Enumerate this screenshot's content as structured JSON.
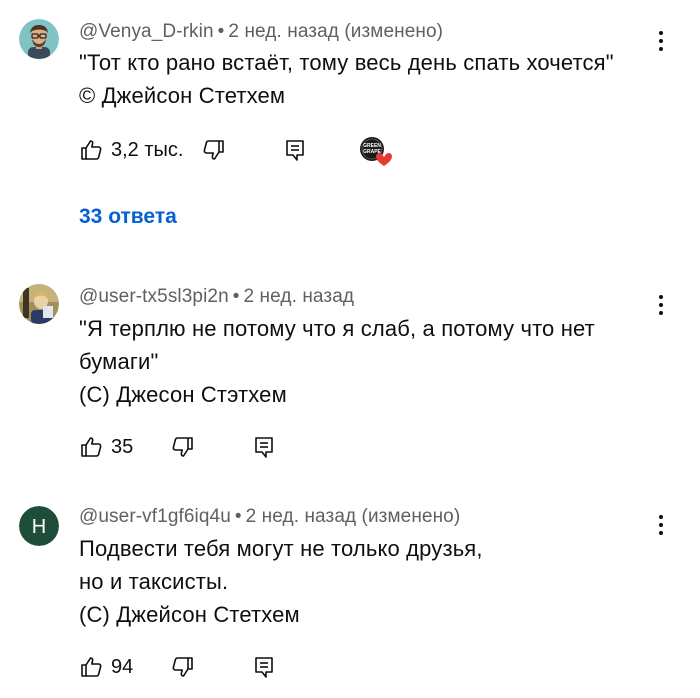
{
  "comments": [
    {
      "author": "@Venya_D-rkin",
      "time": "2 нед. назад (изменено)",
      "lines": [
        "\"Тот кто рано встаёт, тому весь день спать хочется\"",
        "© Джейсон Стетхем"
      ],
      "likes": "3,2 тыс.",
      "replies": "33 ответа",
      "creator_heart": true,
      "creator_badge_text": "GREEN GRAPE"
    },
    {
      "author": "@user-tx5sl3pi2n",
      "time": "2 нед. назад",
      "lines": [
        "\"Я терплю не потому что я слаб, а потому что нет",
        "бумаги\"",
        "(С) Джесон Стэтхем"
      ],
      "likes": "35"
    },
    {
      "author": "@user-vf1gf6iq4u",
      "time": "2 нед. назад (изменено)",
      "avatar_letter": "Н",
      "avatar_color": "#1e4d3a",
      "lines": [
        "Подвести тебя могут не только друзья,",
        "но и таксисты.",
        "(С) Джейсон Стетхем"
      ],
      "likes": "94"
    }
  ],
  "colors": {
    "text": "#0f0f0f",
    "meta": "#606060",
    "link": "#065fd4",
    "heart": "#e53935"
  },
  "icons": [
    "like-icon",
    "dislike-icon",
    "reply-icon",
    "more-vert-icon",
    "heart-icon"
  ]
}
